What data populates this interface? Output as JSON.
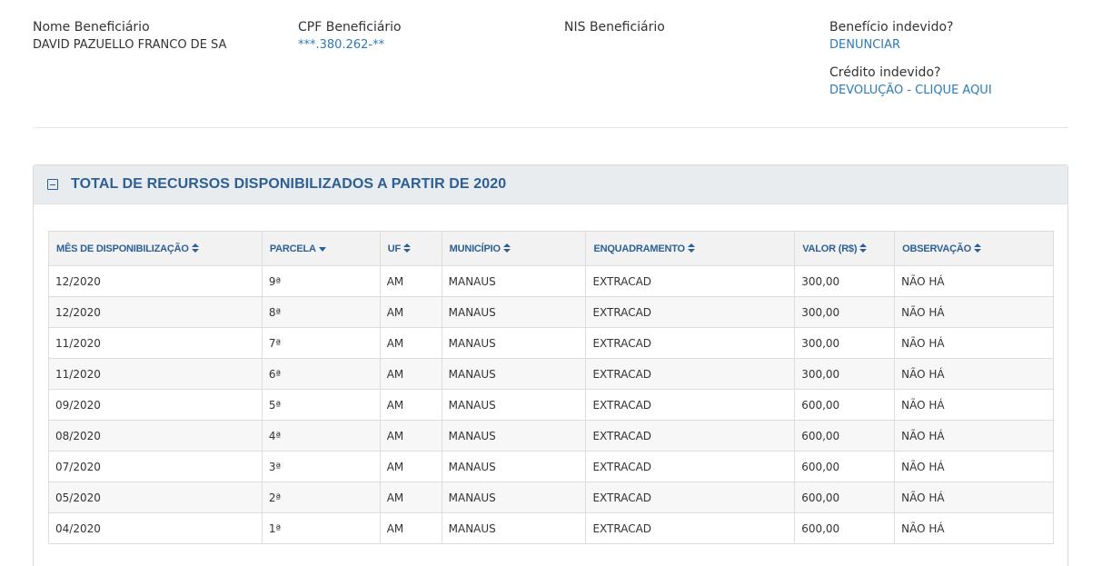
{
  "beneficiary": {
    "name_label": "Nome Beneficiário",
    "name_value": "DAVID PAZUELLO FRANCO DE SA",
    "cpf_label": "CPF Beneficiário",
    "cpf_value": "***.380.262-**",
    "nis_label": "NIS Beneficiário",
    "undue_benefit_label": "Benefício indevido?",
    "undue_benefit_link": "DENUNCIAR",
    "undue_credit_label": "Crédito indevido?",
    "undue_credit_link": "DEVOLUÇÃO - CLIQUE AQUI"
  },
  "panel": {
    "title": "TOTAL DE RECURSOS DISPONIBILIZADOS A PARTIR DE 2020"
  },
  "table": {
    "columns": [
      {
        "label": "MÊS DE DISPONIBILIZAÇÃO",
        "sort": "both"
      },
      {
        "label": "PARCELA",
        "sort": "desc"
      },
      {
        "label": "UF",
        "sort": "both"
      },
      {
        "label": "MUNICÍPIO",
        "sort": "both"
      },
      {
        "label": "ENQUADRAMENTO",
        "sort": "both"
      },
      {
        "label": "VALOR (R$)",
        "sort": "both"
      },
      {
        "label": "OBSERVAÇÃO",
        "sort": "both"
      }
    ],
    "rows": [
      [
        "12/2020",
        "9ª",
        "AM",
        "MANAUS",
        "EXTRACAD",
        "300,00",
        "NÃO HÁ"
      ],
      [
        "12/2020",
        "8ª",
        "AM",
        "MANAUS",
        "EXTRACAD",
        "300,00",
        "NÃO HÁ"
      ],
      [
        "11/2020",
        "7ª",
        "AM",
        "MANAUS",
        "EXTRACAD",
        "300,00",
        "NÃO HÁ"
      ],
      [
        "11/2020",
        "6ª",
        "AM",
        "MANAUS",
        "EXTRACAD",
        "300,00",
        "NÃO HÁ"
      ],
      [
        "09/2020",
        "5ª",
        "AM",
        "MANAUS",
        "EXTRACAD",
        "600,00",
        "NÃO HÁ"
      ],
      [
        "08/2020",
        "4ª",
        "AM",
        "MANAUS",
        "EXTRACAD",
        "600,00",
        "NÃO HÁ"
      ],
      [
        "07/2020",
        "3ª",
        "AM",
        "MANAUS",
        "EXTRACAD",
        "600,00",
        "NÃO HÁ"
      ],
      [
        "05/2020",
        "2ª",
        "AM",
        "MANAUS",
        "EXTRACAD",
        "600,00",
        "NÃO HÁ"
      ],
      [
        "04/2020",
        "1ª",
        "AM",
        "MANAUS",
        "EXTRACAD",
        "600,00",
        "NÃO HÁ"
      ]
    ]
  }
}
